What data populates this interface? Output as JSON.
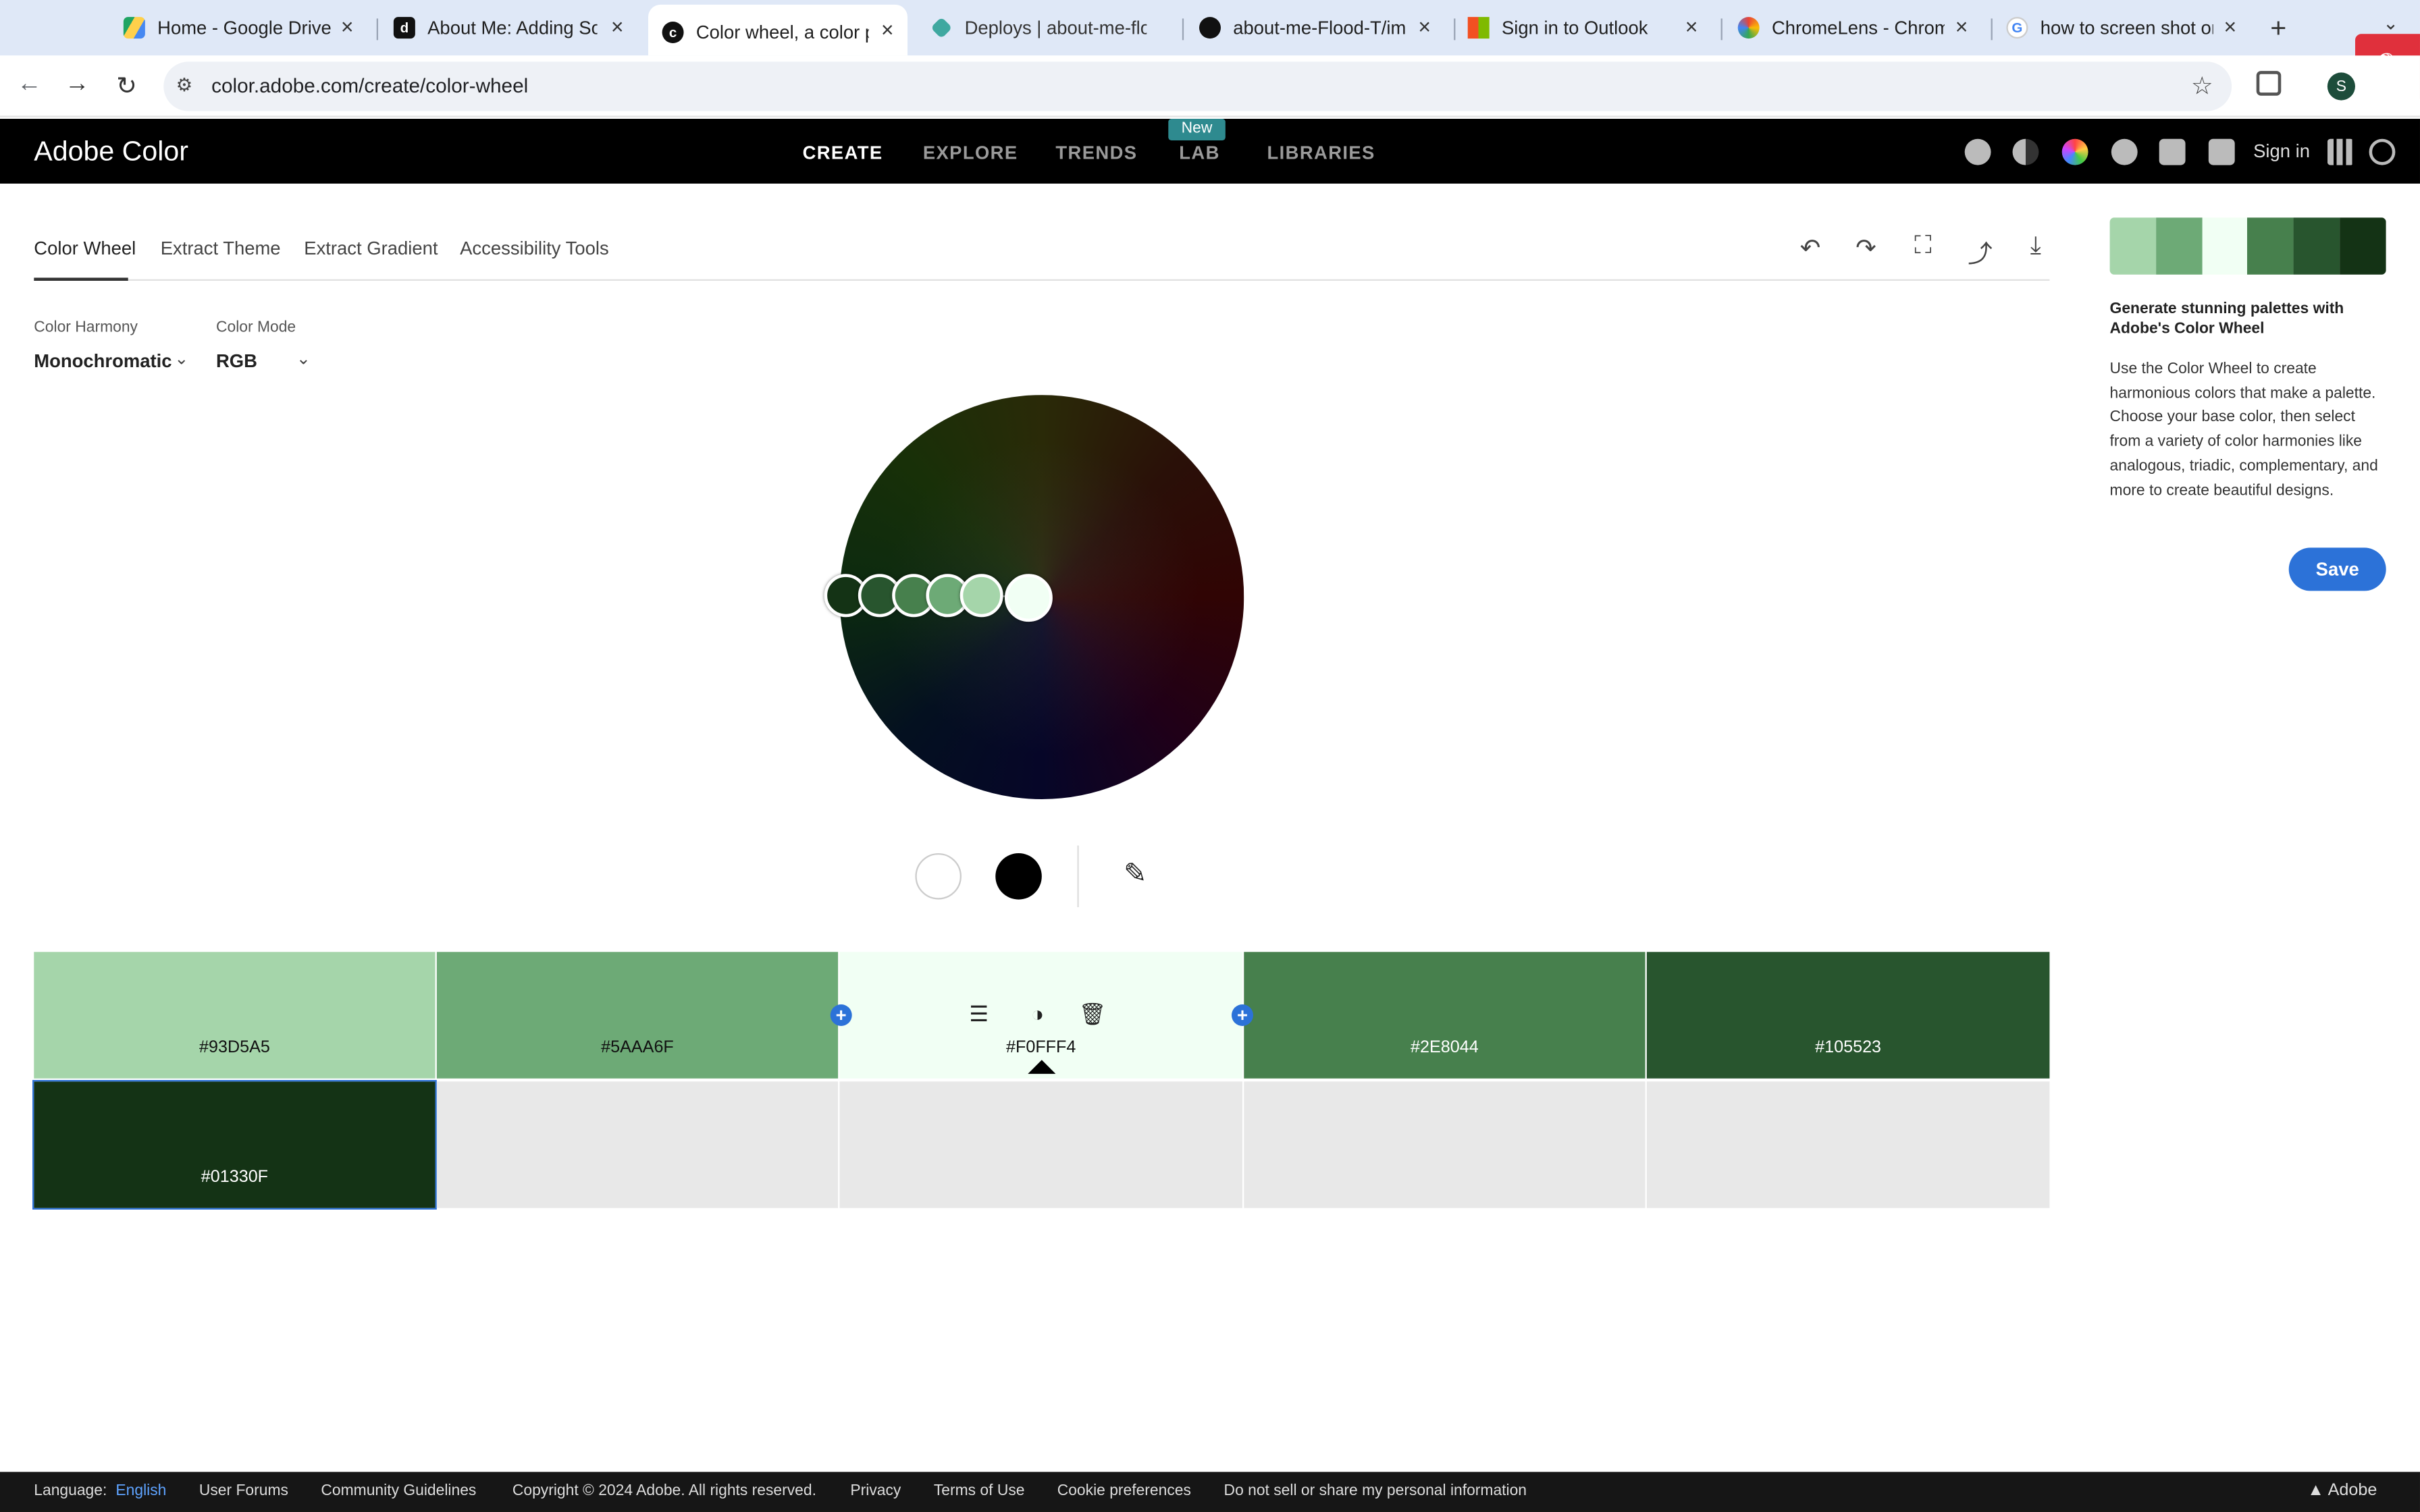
{
  "browser": {
    "tabs": [
      {
        "title": "Home - Google Drive",
        "favicon": "google-drive-icon"
      },
      {
        "title": "About Me: Adding Som",
        "favicon": "notion-icon"
      },
      {
        "title": "Color wheel, a color pa",
        "favicon": "adobe-color-icon"
      },
      {
        "title": "Deploys | about-me-flo",
        "favicon": "netlify-icon"
      },
      {
        "title": "about-me-Flood-T/ima",
        "favicon": "github-icon"
      },
      {
        "title": "Sign in to Outlook",
        "favicon": "microsoft-icon"
      },
      {
        "title": "ChromeLens - Chrome",
        "favicon": "chromelens-icon"
      },
      {
        "title": "how to screen shot on",
        "favicon": "google-icon"
      }
    ],
    "url": "color.adobe.com/create/color-wheel",
    "profile_initial": "S"
  },
  "header": {
    "brand": "Adobe Color",
    "nav": [
      "CREATE",
      "EXPLORE",
      "TRENDS",
      "LAB",
      "LIBRARIES"
    ],
    "new_badge": "New",
    "sign_in": "Sign in"
  },
  "subtabs": [
    "Color Wheel",
    "Extract Theme",
    "Extract Gradient",
    "Accessibility Tools"
  ],
  "controls": {
    "harmony_label": "Color Harmony",
    "harmony_value": "Monochromatic",
    "mode_label": "Color Mode",
    "mode_value": "RGB"
  },
  "palette": [
    {
      "hex": "#93D5A5",
      "color": "#A5D5AA",
      "text_color": "#111111"
    },
    {
      "hex": "#5AAA6F",
      "color": "#6DAA76",
      "text_color": "#111111"
    },
    {
      "hex": "#F0FFF4",
      "color": "#F1FFF4",
      "text_color": "#111111"
    },
    {
      "hex": "#2E8044",
      "color": "#47804D",
      "text_color": "#ffffff"
    },
    {
      "hex": "#105523",
      "color": "#28552E",
      "text_color": "#ffffff"
    },
    {
      "hex": "#01330F",
      "color": "#143315",
      "text_color": "#ffffff"
    }
  ],
  "right_panel": {
    "title": "Generate stunning palettes with Adobe's Color Wheel",
    "body": "Use the Color Wheel to create harmonious colors that make a palette. Choose your base color, then select from a variety of color harmonies like analogous, triadic, complementary, and more to create beautiful designs.",
    "save": "Save"
  },
  "footer": {
    "language_label": "Language:",
    "language_value": "English",
    "links": [
      "User Forums",
      "Community Guidelines",
      "Copyright © 2024 Adobe. All rights reserved.",
      "Privacy",
      "Terms of Use",
      "Cookie preferences",
      "Do not sell or share my personal information"
    ],
    "adobe": "Adobe"
  }
}
